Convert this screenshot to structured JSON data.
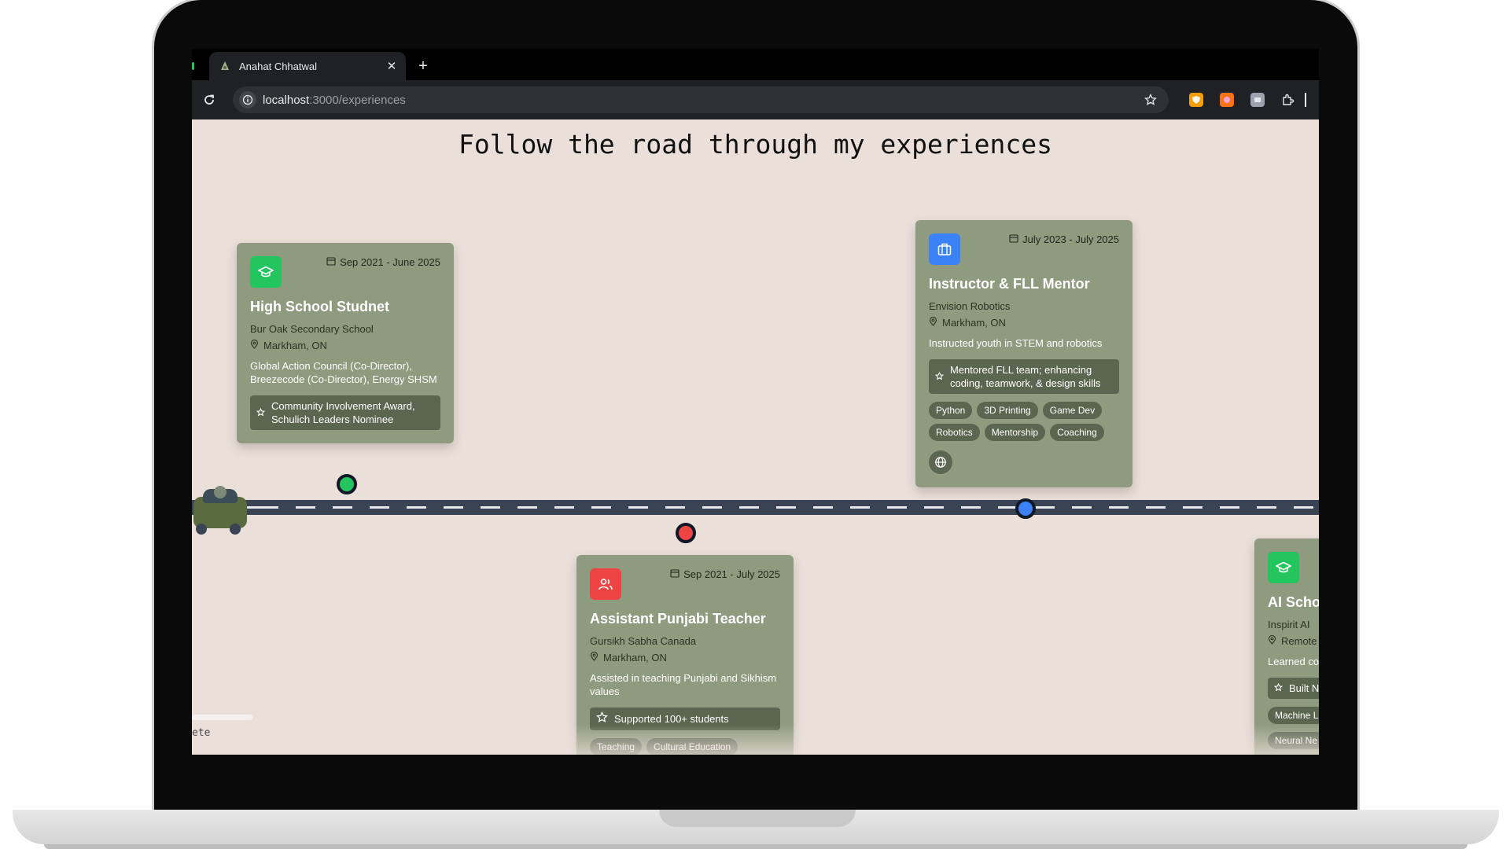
{
  "browser": {
    "tab_title": "Anahat Chhatwal",
    "tab_close": "✕",
    "new_tab": "+",
    "url_host": "localhost",
    "url_path": ":3000/experiences"
  },
  "page": {
    "title": "Follow the road through my experiences",
    "progress_label": "ete"
  },
  "colors": {
    "page_bg": "#ebdfd9",
    "card_bg": "#8f9b7f",
    "road": "#394354",
    "education": "#22c55e",
    "work": "#3b82f6",
    "volunteer": "#ef4444"
  },
  "experiences": [
    {
      "icon": "graduation-cap-icon",
      "date": "Sep 2021 - June 2025",
      "title": "High School Studnet",
      "org": "Bur Oak Secondary School",
      "location": "Markham, ON",
      "description": "Global Action Council (Co-Director), Breezecode (Co-Director), Energy SHSM",
      "award": "Community Involvement Award, Schulich Leaders Nominee",
      "tags": []
    },
    {
      "icon": "users-icon",
      "date": "Sep 2021 - July 2025",
      "title": "Assistant Punjabi Teacher",
      "org": "Gursikh Sabha Canada",
      "location": "Markham, ON",
      "description": "Assisted in teaching Punjabi and Sikhism values",
      "award": "Supported 100+ students",
      "tags": [
        "Teaching",
        "Cultural Education"
      ]
    },
    {
      "icon": "briefcase-icon",
      "date": "July 2023 - July 2025",
      "title": "Instructor & FLL Mentor",
      "org": "Envision Robotics",
      "location": "Markham, ON",
      "description": "Instructed youth in STEM and robotics",
      "award": "Mentored FLL team; enhancing coding, teamwork, & design skills",
      "tags": [
        "Python",
        "3D Printing",
        "Game Dev",
        "Robotics",
        "Mentorship",
        "Coaching"
      ]
    },
    {
      "icon": "graduation-cap-icon",
      "title": "AI Scho",
      "org": "Inspirit AI",
      "location": "Remote",
      "description": "Learned co",
      "award": "Built N stock r",
      "tags": [
        "Machine L",
        "Neural Ne"
      ]
    }
  ]
}
